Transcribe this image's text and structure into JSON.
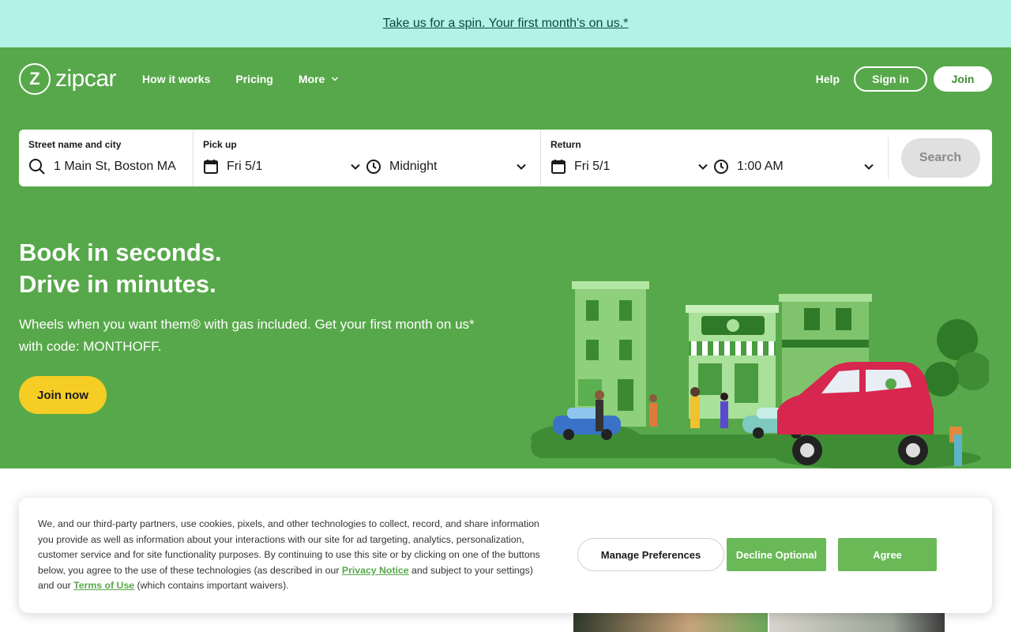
{
  "promo": {
    "text": "Take us for a spin. Your first month's on us.*"
  },
  "nav": {
    "logo_text": "zipcar",
    "logo_mark": "Z",
    "links": [
      {
        "label": "How it works"
      },
      {
        "label": "Pricing"
      },
      {
        "label": "More"
      }
    ],
    "help_label": "Help",
    "signin_label": "Sign in",
    "join_label": "Join"
  },
  "search": {
    "street": {
      "label": "Street name and city",
      "placeholder": "1 Main St, Boston MA"
    },
    "pickup": {
      "label": "Pick up",
      "date": "Fri 5/1",
      "time": "Midnight"
    },
    "return": {
      "label": "Return",
      "date": "Fri 5/1",
      "time": "1:00 AM"
    },
    "button_label": "Search"
  },
  "hero": {
    "headline_1": "Book in seconds.",
    "headline_2": "Drive in minutes.",
    "subcopy": "Wheels when you want them® with gas included. Get your first month on us* with code: MONTHOFF.",
    "cta_label": "Join now"
  },
  "cookie": {
    "text_before_privacy": "We, and our third-party partners, use cookies, pixels, and other technologies to collect, record, and share information you provide as well as information about your interactions with our site for ad targeting, analytics, personalization, customer service and for site functionality purposes. By continuing to use this site or by clicking on one of the buttons below, you agree to the use of these technologies (as described in our ",
    "privacy_link": "Privacy Notice",
    "text_between": " and subject to your settings) and our ",
    "terms_link": "Terms of Use",
    "text_after": " (which contains important waivers).",
    "manage_label": "Manage Preferences",
    "decline_label": "Decline Optional",
    "agree_label": "Agree"
  },
  "colors": {
    "brand_green": "#57a84a",
    "promo_bg": "#b3f2e6",
    "cta_yellow": "#f6cd24",
    "button_green": "#69b957"
  },
  "icons": [
    "search-icon",
    "calendar-icon",
    "clock-icon",
    "chevron-down-icon"
  ]
}
